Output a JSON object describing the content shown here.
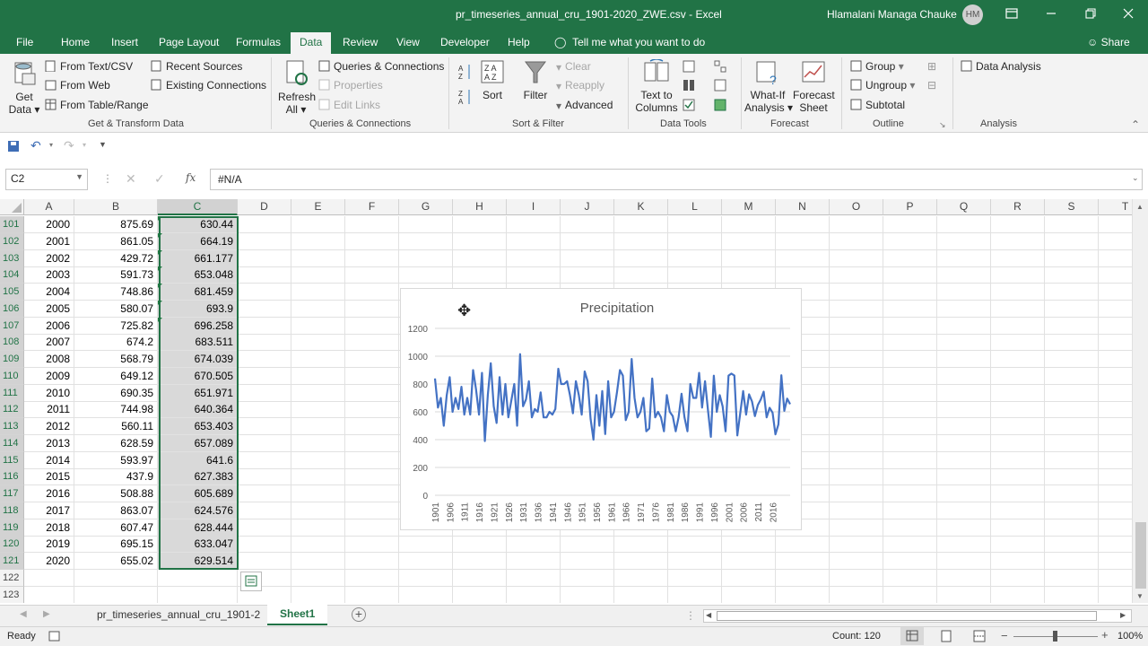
{
  "window": {
    "title": "pr_timeseries_annual_cru_1901-2020_ZWE.csv  -  Excel",
    "user": "Hlamalani Managa Chauke",
    "initials": "HM"
  },
  "tabs": [
    "File",
    "Home",
    "Insert",
    "Page Layout",
    "Formulas",
    "Data",
    "Review",
    "View",
    "Developer",
    "Help"
  ],
  "active_tab": "Data",
  "tell_me": "Tell me what you want to do",
  "share": "Share",
  "ribbon": {
    "get_data": "Get Data",
    "get_data_l1": "Get",
    "get_data_l2": "Data",
    "from_text_csv": "From Text/CSV",
    "from_web": "From Web",
    "from_table_range": "From Table/Range",
    "recent_sources": "Recent Sources",
    "existing_connections": "Existing Connections",
    "group_get_transform": "Get & Transform Data",
    "refresh_l1": "Refresh",
    "refresh_l2": "All",
    "queries_connections": "Queries & Connections",
    "properties": "Properties",
    "edit_links": "Edit Links",
    "group_queries": "Queries & Connections",
    "sort": "Sort",
    "filter": "Filter",
    "clear": "Clear",
    "reapply": "Reapply",
    "advanced": "Advanced",
    "group_sort_filter": "Sort & Filter",
    "text_to_columns_l1": "Text to",
    "text_to_columns_l2": "Columns",
    "group_data_tools": "Data Tools",
    "what_if_l1": "What-If",
    "what_if_l2": "Analysis",
    "forecast_sheet_l1": "Forecast",
    "forecast_sheet_l2": "Sheet",
    "group_forecast": "Forecast",
    "group": "Group",
    "ungroup": "Ungroup",
    "subtotal": "Subtotal",
    "group_outline": "Outline",
    "data_analysis": "Data Analysis",
    "group_analysis": "Analysis"
  },
  "formula_bar": {
    "name_box": "C2",
    "formula": "#N/A",
    "fx": "fx"
  },
  "columns": [
    "A",
    "B",
    "C",
    "D",
    "E",
    "F",
    "G",
    "H",
    "I",
    "J",
    "K",
    "L",
    "M",
    "N",
    "O",
    "P",
    "Q",
    "R",
    "S",
    "T"
  ],
  "rows": [
    {
      "n": "101",
      "a": "2000",
      "b": "875.69",
      "c": "630.44"
    },
    {
      "n": "102",
      "a": "2001",
      "b": "861.05",
      "c": "664.19"
    },
    {
      "n": "103",
      "a": "2002",
      "b": "429.72",
      "c": "661.177"
    },
    {
      "n": "104",
      "a": "2003",
      "b": "591.73",
      "c": "653.048"
    },
    {
      "n": "105",
      "a": "2004",
      "b": "748.86",
      "c": "681.459"
    },
    {
      "n": "106",
      "a": "2005",
      "b": "580.07",
      "c": "693.9"
    },
    {
      "n": "107",
      "a": "2006",
      "b": "725.82",
      "c": "696.258"
    },
    {
      "n": "108",
      "a": "2007",
      "b": "674.2",
      "c": "683.511"
    },
    {
      "n": "109",
      "a": "2008",
      "b": "568.79",
      "c": "674.039"
    },
    {
      "n": "110",
      "a": "2009",
      "b": "649.12",
      "c": "670.505"
    },
    {
      "n": "111",
      "a": "2010",
      "b": "690.35",
      "c": "651.971"
    },
    {
      "n": "112",
      "a": "2011",
      "b": "744.98",
      "c": "640.364"
    },
    {
      "n": "113",
      "a": "2012",
      "b": "560.11",
      "c": "653.403"
    },
    {
      "n": "114",
      "a": "2013",
      "b": "628.59",
      "c": "657.089"
    },
    {
      "n": "115",
      "a": "2014",
      "b": "593.97",
      "c": "641.6"
    },
    {
      "n": "116",
      "a": "2015",
      "b": "437.9",
      "c": "627.383"
    },
    {
      "n": "117",
      "a": "2016",
      "b": "508.88",
      "c": "605.689"
    },
    {
      "n": "118",
      "a": "2017",
      "b": "863.07",
      "c": "624.576"
    },
    {
      "n": "119",
      "a": "2018",
      "b": "607.47",
      "c": "628.444"
    },
    {
      "n": "120",
      "a": "2019",
      "b": "695.15",
      "c": "633.047"
    },
    {
      "n": "121",
      "a": "2020",
      "b": "655.02",
      "c": "629.514"
    },
    {
      "n": "122",
      "a": "",
      "b": "",
      "c": ""
    },
    {
      "n": "123",
      "a": "",
      "b": "",
      "c": ""
    }
  ],
  "chart_data": {
    "type": "line",
    "title": "Precipitation",
    "ylim": [
      0,
      1200
    ],
    "yticks": [
      "0",
      "200",
      "400",
      "600",
      "800",
      "1000",
      "1200"
    ],
    "xticks": [
      "1901",
      "1906",
      "1911",
      "1916",
      "1921",
      "1926",
      "1931",
      "1936",
      "1941",
      "1946",
      "1951",
      "1956",
      "1961",
      "1966",
      "1971",
      "1976",
      "1981",
      "1986",
      "1991",
      "1996",
      "2001",
      "2006",
      "2011",
      "2016"
    ],
    "x_start": 1901,
    "series": [
      {
        "values": [
          840,
          630,
          700,
          500,
          720,
          850,
          600,
          700,
          620,
          780,
          580,
          700,
          580,
          900,
          760,
          580,
          880,
          390,
          720,
          950,
          640,
          520,
          850,
          580,
          800,
          560,
          680,
          800,
          500,
          1015,
          640,
          690,
          820,
          560,
          620,
          600,
          740,
          560,
          560,
          600,
          580,
          620,
          910,
          800,
          800,
          820,
          720,
          590,
          820,
          720,
          580,
          890,
          820,
          550,
          400,
          720,
          500,
          750,
          440,
          820,
          560,
          600,
          740,
          900,
          860,
          540,
          600,
          980,
          700,
          560,
          600,
          700,
          460,
          480,
          840,
          560,
          600,
          560,
          460,
          720,
          600,
          570,
          460,
          560,
          730,
          560,
          460,
          800,
          700,
          700,
          880,
          630,
          820,
          610,
          420,
          860,
          600,
          720,
          640,
          460,
          860,
          875,
          861,
          430,
          592,
          749,
          580,
          726,
          674,
          569,
          649,
          690,
          745,
          560,
          629,
          594,
          438,
          509,
          863,
          607,
          695,
          655
        ]
      }
    ],
    "line_color": "#4472c4"
  },
  "sheet_tabs": [
    "pr_timeseries_annual_cru_1901-2",
    "Sheet1"
  ],
  "active_sheet": "Sheet1",
  "status": {
    "ready": "Ready",
    "count": "Count: 120",
    "zoom": "100%"
  }
}
